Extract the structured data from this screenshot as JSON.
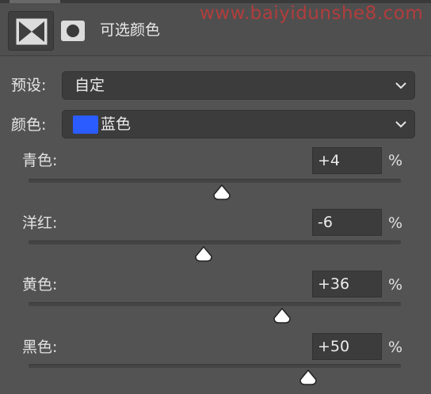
{
  "watermark": "www.baiyidunshe8.com",
  "header": {
    "title": "可选颜色"
  },
  "preset": {
    "label": "预设:",
    "value": "自定"
  },
  "color": {
    "label": "颜色:",
    "value": "蓝色",
    "swatch": "#2a5cff"
  },
  "sliders": [
    {
      "label": "青色:",
      "value": "+4",
      "percent": "%",
      "numeric": 4,
      "min": -100,
      "max": 100
    },
    {
      "label": "洋红:",
      "value": "-6",
      "percent": "%",
      "numeric": -6,
      "min": -100,
      "max": 100
    },
    {
      "label": "黄色:",
      "value": "+36",
      "percent": "%",
      "numeric": 36,
      "min": -100,
      "max": 100
    },
    {
      "label": "黑色:",
      "value": "+50",
      "percent": "%",
      "numeric": 50,
      "min": -100,
      "max": 100
    }
  ],
  "icons": {
    "mask": "layer-mask-icon",
    "circle": "vector-mask-icon",
    "chevron": "chevron-down-icon",
    "thumb": "slider-thumb-icon"
  }
}
